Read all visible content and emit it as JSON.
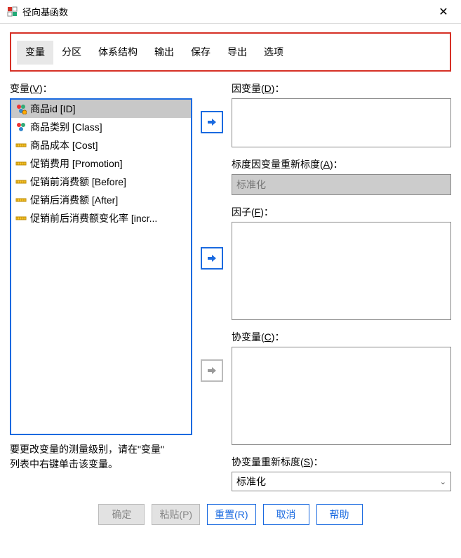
{
  "window": {
    "title": "径向基函数"
  },
  "tabs": [
    "变量",
    "分区",
    "体系结构",
    "输出",
    "保存",
    "导出",
    "选项"
  ],
  "activeTab": 0,
  "left": {
    "label": "变量(",
    "labelKey": "V",
    "labelEnd": ")：",
    "items": [
      {
        "label": "商品id [ID]",
        "icon": "nominal-warn",
        "selected": true
      },
      {
        "label": "商品类别 [Class]",
        "icon": "nominal",
        "selected": false
      },
      {
        "label": "商品成本 [Cost]",
        "icon": "scale",
        "selected": false
      },
      {
        "label": "促销费用 [Promotion]",
        "icon": "scale",
        "selected": false
      },
      {
        "label": "促销前消费额 [Before]",
        "icon": "scale",
        "selected": false
      },
      {
        "label": "促销后消费额 [After]",
        "icon": "scale",
        "selected": false
      },
      {
        "label": "促销前后消费额变化率 [incr...",
        "icon": "scale",
        "selected": false
      }
    ],
    "hint1": "要更改变量的测量级别，请在\"变量\"",
    "hint2": "列表中右键单击该变量。"
  },
  "right": {
    "depLabel": "因变量(",
    "depKey": "D",
    "depEnd": ")：",
    "rescaleDepLabel": "标度因变量重新标度(",
    "rescaleDepKey": "A",
    "rescaleDepEnd": ")：",
    "rescaleDepValue": "标准化",
    "facLabel": "因子(",
    "facKey": "F",
    "facEnd": ")：",
    "covLabel": "协变量(",
    "covKey": "C",
    "covEnd": ")：",
    "rescaleCovLabel": "协变量重新标度(",
    "rescaleCovKey": "S",
    "rescaleCovEnd": ")：",
    "rescaleCovValue": "标准化"
  },
  "buttons": {
    "ok": "确定",
    "paste": "粘贴(P)",
    "reset": "重置(R)",
    "cancel": "取消",
    "help": "帮助"
  }
}
